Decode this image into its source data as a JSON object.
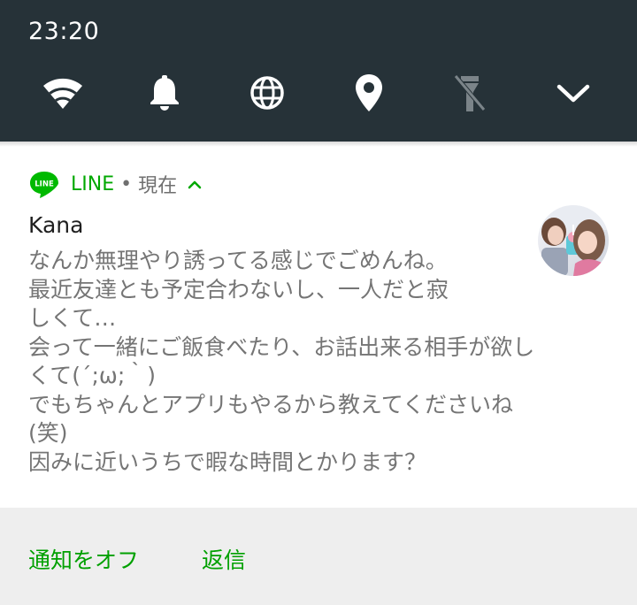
{
  "status_bar": {
    "time": "23:20"
  },
  "quick_settings": [
    {
      "icon": "wifi-icon"
    },
    {
      "icon": "bell-icon"
    },
    {
      "icon": "globe-icon"
    },
    {
      "icon": "location-icon"
    },
    {
      "icon": "flashlight-off-icon"
    },
    {
      "icon": "chevron-down-icon"
    }
  ],
  "notification": {
    "app_icon": "line-app-icon",
    "app_name": "LINE",
    "separator": "•",
    "time": "現在",
    "sender": "Kana",
    "message_lines": [
      "なんか無理やり誘ってる感じでごめんね。",
      "最近友達とも予定合わないし、一人だと寂",
      "しくて…",
      "会って一緒にご飯食べたり、お話出来る相手が欲し",
      "くて(´;ω;｀)",
      "でもちゃんとアプリもやるから教えてくださいね",
      "(笑)",
      "因みに近いうちで暇な時間とかります？"
    ],
    "actions": {
      "turn_off": "通知をオフ",
      "reply": "返信"
    }
  },
  "colors": {
    "shade_bg": "#263238",
    "line_green": "#00b900",
    "action_green": "#00a000",
    "message_gray": "#757575",
    "actions_bg": "#eeeeee"
  }
}
